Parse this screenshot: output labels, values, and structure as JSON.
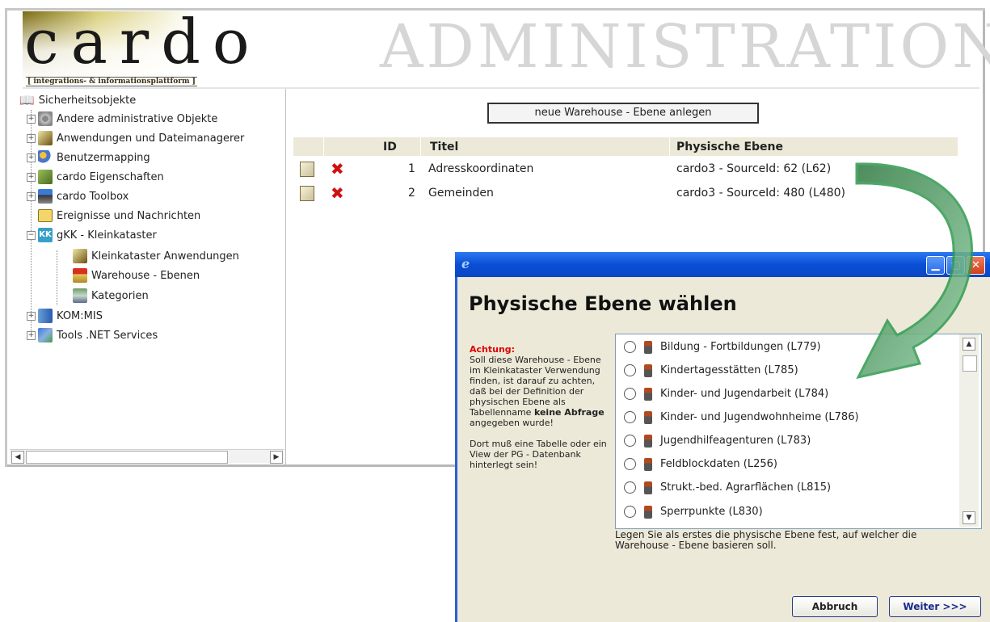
{
  "header": {
    "logo_text": "cardo",
    "logo_subtitle": "[ integrations- & informationsplattform ]",
    "title": "ADMINISTRATION"
  },
  "tree": {
    "root": {
      "label": "Sicherheitsobjekte",
      "icon": "book-icon"
    },
    "items": [
      {
        "label": "Andere administrative Objekte",
        "icon": "gears-icon",
        "expander": "+"
      },
      {
        "label": "Anwendungen und Dateimanagerer",
        "icon": "pen-tool-icon",
        "expander": "+"
      },
      {
        "label": "Benutzermapping",
        "icon": "users-icon",
        "expander": "+"
      },
      {
        "label": "cardo Eigenschaften",
        "icon": "properties-icon",
        "expander": "+"
      },
      {
        "label": "cardo Toolbox",
        "icon": "toolbox-icon",
        "expander": "+"
      },
      {
        "label": "Ereignisse und Nachrichten",
        "icon": "message-icon",
        "expander": ""
      },
      {
        "label": "gKK - Kleinkataster",
        "icon": "kk-icon",
        "expander": "−"
      },
      {
        "label": "Kleinkataster Anwendungen",
        "icon": "pen-tool-icon",
        "expander": ""
      },
      {
        "label": "Warehouse - Ebenen",
        "icon": "warehouse-icon",
        "expander": ""
      },
      {
        "label": "Kategorien",
        "icon": "layers-icon",
        "expander": ""
      },
      {
        "label": "KOM:MIS",
        "icon": "book-icon",
        "expander": "+"
      },
      {
        "label": "Tools .NET Services",
        "icon": "tools-icon",
        "expander": "+"
      }
    ]
  },
  "main": {
    "new_button": "neue Warehouse - Ebene anlegen",
    "columns": [
      "ID",
      "Titel",
      "Physische Ebene"
    ],
    "rows": [
      {
        "id": "1",
        "title": "Adresskoordinaten",
        "layer": "cardo3 - SourceId: 62 (L62)"
      },
      {
        "id": "2",
        "title": "Gemeinden",
        "layer": "cardo3 - SourceId: 480 (L480)"
      }
    ]
  },
  "dialog": {
    "title_icon": "ie-icon",
    "heading": "Physische Ebene wählen",
    "warning_title": "Achtung:",
    "warning_text_1": "Soll diese Warehouse - Ebene im Kleinkataster Verwendung finden, ist darauf zu achten, daß bei der Definition der physischen Ebene als Tabellenname",
    "warning_bold_1": "keine Abfrage",
    "warning_text_2": "angegeben wurde!",
    "warning_text_3": "Dort muß eine Tabelle oder ein View der PG - Datenbank hinterlegt sein!",
    "options": [
      "Bildung - Fortbildungen (L779)",
      "Kindertagesstätten (L785)",
      "Kinder- und Jugendarbeit (L784)",
      "Kinder- und Jugendwohnheime (L786)",
      "Jugendhilfeagenturen (L783)",
      "Feldblockdaten (L256)",
      "Strukt.-bed. Agrarflächen (L815)",
      "Sperrpunkte (L830)"
    ],
    "hint": "Legen Sie als erstes die physische Ebene fest, auf welcher die Warehouse - Ebene basieren soll.",
    "cancel_label": "Abbruch",
    "next_label": "Weiter >>>"
  },
  "colors": {
    "dialog_title": "#0a4fd6",
    "warning": "#e00000",
    "arrow": "#2e9a4e",
    "delete": "#d11111"
  }
}
